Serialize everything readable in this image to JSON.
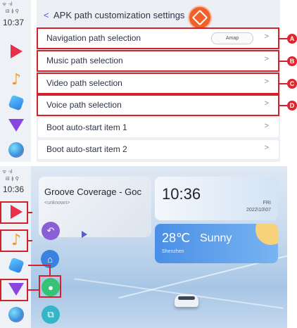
{
  "top": {
    "status": {
      "signal": "ᯤ ·ıl",
      "icons": "⊟ ≬ ⚲",
      "time": "10:37"
    },
    "back_icon": "<",
    "title": "APK path customization settings",
    "rows": [
      {
        "label": "Navigation path selection",
        "value": "Amap",
        "arrow": ">",
        "marker": "A"
      },
      {
        "label": "Music path selection",
        "arrow": ">",
        "marker": "B"
      },
      {
        "label": "Video path selection",
        "arrow": ">",
        "marker": "C"
      },
      {
        "label": "Voice path selection",
        "arrow": ">",
        "marker": "D"
      },
      {
        "label": "Boot auto-start item 1",
        "arrow": ">"
      },
      {
        "label": "Boot auto-start item 2",
        "arrow": ">"
      }
    ]
  },
  "bottom": {
    "status": {
      "signal": "ᯤ ·ıl",
      "icons": "⊟ ≬ ⚲",
      "time": "10:36"
    },
    "music": {
      "title": "Groove Coverage - Goc",
      "artist": "<unknown>"
    },
    "clock": {
      "time": "10:36",
      "day": "FRI",
      "date": "2022\\10\\07"
    },
    "weather": {
      "temp": "28℃",
      "condition": "Sunny",
      "city": "Shenzhen"
    }
  },
  "colors": {
    "accent": "#4a5fd0",
    "marker_red": "#d3222a",
    "logo_orange": "#f2602a"
  }
}
